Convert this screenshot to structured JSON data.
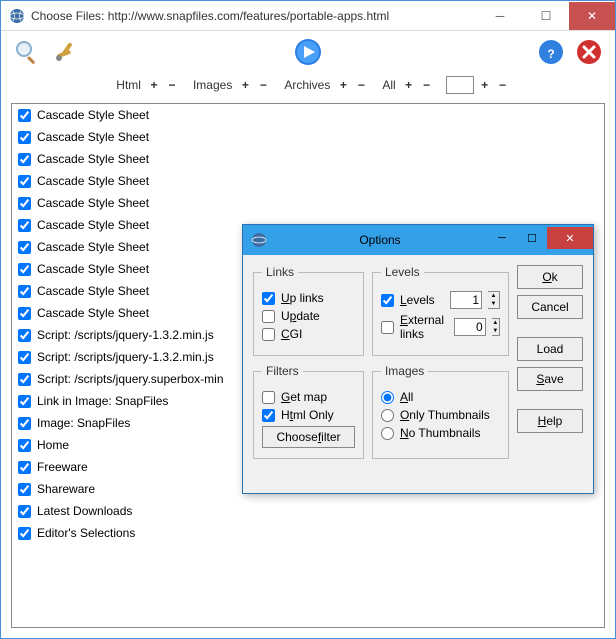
{
  "window": {
    "title": "Choose Files: http://www.snapfiles.com/features/portable-apps.html"
  },
  "filterbar": {
    "html": "Html",
    "images": "Images",
    "archives": "Archives",
    "all": "All"
  },
  "list": [
    "Cascade Style Sheet",
    "Cascade Style Sheet",
    "Cascade Style Sheet",
    "Cascade Style Sheet",
    "Cascade Style Sheet",
    "Cascade Style Sheet",
    "Cascade Style Sheet",
    "Cascade Style Sheet",
    "Cascade Style Sheet",
    "Cascade Style Sheet",
    "Script: /scripts/jquery-1.3.2.min.js",
    "Script: /scripts/jquery-1.3.2.min.js",
    "Script: /scripts/jquery.superbox-min",
    "Link in Image: SnapFiles",
    "Image: SnapFiles",
    "Home",
    "Freeware",
    "Shareware",
    "Latest Downloads",
    "Editor's Selections"
  ],
  "dialog": {
    "title": "Options",
    "groups": {
      "links": "Links",
      "levels": "Levels",
      "filters": "Filters",
      "images": "Images"
    },
    "links": {
      "uplinks": "Up links",
      "update": "Update",
      "cgi": "CGI"
    },
    "levels": {
      "levels": "Levels",
      "levels_value": "1",
      "external": "External links",
      "external_value": "0"
    },
    "filters": {
      "getmap": "Get map",
      "htmlonly": "Html Only",
      "choose": "Choose filter"
    },
    "images": {
      "all": "All",
      "only": "Only Thumbnails",
      "none": "No Thumbnails"
    },
    "buttons": {
      "ok": "Ok",
      "cancel": "Cancel",
      "load": "Load",
      "save": "Save",
      "help": "Help"
    }
  }
}
